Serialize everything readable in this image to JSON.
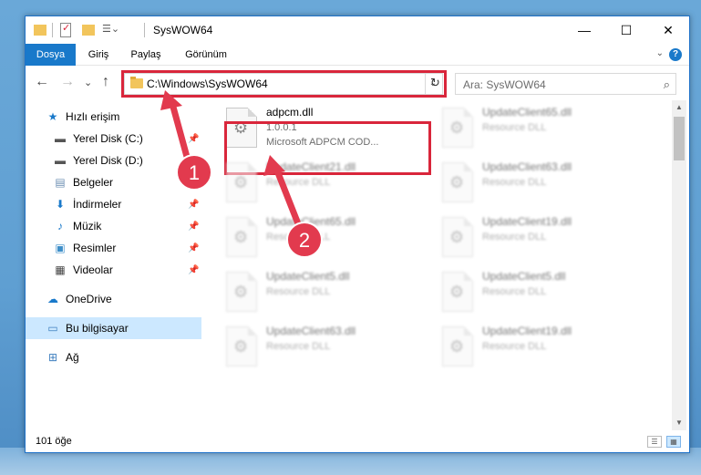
{
  "window": {
    "title": "SysWOW64",
    "minimize_glyph": "—",
    "maximize_glyph": "☐",
    "close_glyph": "✕"
  },
  "ribbon": {
    "tabs": [
      {
        "label": "Dosya",
        "active": true
      },
      {
        "label": "Giriş"
      },
      {
        "label": "Paylaş"
      },
      {
        "label": "Görünüm"
      }
    ],
    "help_glyph": "?",
    "expand_glyph": "⌄"
  },
  "nav": {
    "back_glyph": "←",
    "forward_glyph": "→",
    "recent_glyph": "⌄",
    "up_glyph": "↑",
    "address_path": "C:\\Windows\\SysWOW64",
    "address_dropdown_glyph": "⌄",
    "refresh_glyph": "↻",
    "search_placeholder": "Ara: SysWOW64",
    "search_icon_glyph": "⌕"
  },
  "sidebar": {
    "items": [
      {
        "label": "Hızlı erişim",
        "icon": "star-icon"
      },
      {
        "label": "Yerel Disk (C:)",
        "icon": "drive-icon",
        "pinned": true
      },
      {
        "label": "Yerel Disk (D:)",
        "icon": "drive-icon",
        "pinned": true
      },
      {
        "label": "Belgeler",
        "icon": "documents-icon",
        "pinned": true
      },
      {
        "label": "İndirmeler",
        "icon": "download-icon",
        "pinned": true
      },
      {
        "label": "Müzik",
        "icon": "music-icon",
        "pinned": true
      },
      {
        "label": "Resimler",
        "icon": "pictures-icon",
        "pinned": true
      },
      {
        "label": "Videolar",
        "icon": "video-icon",
        "pinned": true
      },
      {
        "label": "OneDrive",
        "icon": "cloud-icon"
      },
      {
        "label": "Bu bilgisayar",
        "icon": "computer-icon",
        "selected": true
      },
      {
        "label": "Ağ",
        "icon": "network-icon"
      }
    ],
    "pin_glyph": "📌"
  },
  "files": {
    "main": {
      "name": "adpcm.dll",
      "version": "1.0.0.1",
      "description": "Microsoft ADPCM COD..."
    },
    "blurred": [
      {
        "name": "UpdateClient65.dll",
        "description": "Resource DLL"
      },
      {
        "name": "UpdateClient21.dll",
        "description": "Resource DLL"
      },
      {
        "name": "UpdateClient63.dll",
        "description": "Resource DLL"
      },
      {
        "name": "UpdateClient65.dll",
        "description": "Resource DLL"
      },
      {
        "name": "UpdateClient19.dll",
        "description": "Resource DLL"
      },
      {
        "name": "UpdateClient5.dll",
        "description": "Resource DLL"
      },
      {
        "name": "UpdateClient5.dll",
        "description": "Resource DLL"
      },
      {
        "name": "UpdateClient63.dll",
        "description": "Resource DLL"
      },
      {
        "name": "UpdateClient19.dll",
        "description": "Resource DLL"
      }
    ]
  },
  "status": {
    "item_count": "101 öğe"
  },
  "annotations": {
    "badge1": "1",
    "badge2": "2",
    "highlight_color": "#d9263b",
    "badge_color": "#e23a4e"
  },
  "colors": {
    "accent": "#1979ca",
    "selection": "#cce8ff"
  }
}
